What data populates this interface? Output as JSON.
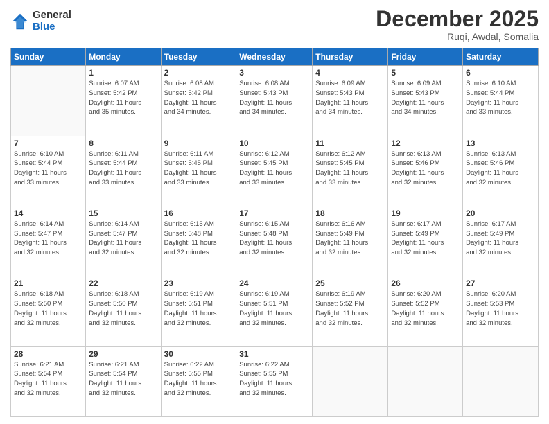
{
  "logo": {
    "general": "General",
    "blue": "Blue"
  },
  "title": "December 2025",
  "location": "Ruqi, Awdal, Somalia",
  "header_days": [
    "Sunday",
    "Monday",
    "Tuesday",
    "Wednesday",
    "Thursday",
    "Friday",
    "Saturday"
  ],
  "weeks": [
    [
      {
        "day": "",
        "info": ""
      },
      {
        "day": "1",
        "info": "Sunrise: 6:07 AM\nSunset: 5:42 PM\nDaylight: 11 hours\nand 35 minutes."
      },
      {
        "day": "2",
        "info": "Sunrise: 6:08 AM\nSunset: 5:42 PM\nDaylight: 11 hours\nand 34 minutes."
      },
      {
        "day": "3",
        "info": "Sunrise: 6:08 AM\nSunset: 5:43 PM\nDaylight: 11 hours\nand 34 minutes."
      },
      {
        "day": "4",
        "info": "Sunrise: 6:09 AM\nSunset: 5:43 PM\nDaylight: 11 hours\nand 34 minutes."
      },
      {
        "day": "5",
        "info": "Sunrise: 6:09 AM\nSunset: 5:43 PM\nDaylight: 11 hours\nand 34 minutes."
      },
      {
        "day": "6",
        "info": "Sunrise: 6:10 AM\nSunset: 5:44 PM\nDaylight: 11 hours\nand 33 minutes."
      }
    ],
    [
      {
        "day": "7",
        "info": "Sunrise: 6:10 AM\nSunset: 5:44 PM\nDaylight: 11 hours\nand 33 minutes."
      },
      {
        "day": "8",
        "info": "Sunrise: 6:11 AM\nSunset: 5:44 PM\nDaylight: 11 hours\nand 33 minutes."
      },
      {
        "day": "9",
        "info": "Sunrise: 6:11 AM\nSunset: 5:45 PM\nDaylight: 11 hours\nand 33 minutes."
      },
      {
        "day": "10",
        "info": "Sunrise: 6:12 AM\nSunset: 5:45 PM\nDaylight: 11 hours\nand 33 minutes."
      },
      {
        "day": "11",
        "info": "Sunrise: 6:12 AM\nSunset: 5:45 PM\nDaylight: 11 hours\nand 33 minutes."
      },
      {
        "day": "12",
        "info": "Sunrise: 6:13 AM\nSunset: 5:46 PM\nDaylight: 11 hours\nand 32 minutes."
      },
      {
        "day": "13",
        "info": "Sunrise: 6:13 AM\nSunset: 5:46 PM\nDaylight: 11 hours\nand 32 minutes."
      }
    ],
    [
      {
        "day": "14",
        "info": "Sunrise: 6:14 AM\nSunset: 5:47 PM\nDaylight: 11 hours\nand 32 minutes."
      },
      {
        "day": "15",
        "info": "Sunrise: 6:14 AM\nSunset: 5:47 PM\nDaylight: 11 hours\nand 32 minutes."
      },
      {
        "day": "16",
        "info": "Sunrise: 6:15 AM\nSunset: 5:48 PM\nDaylight: 11 hours\nand 32 minutes."
      },
      {
        "day": "17",
        "info": "Sunrise: 6:15 AM\nSunset: 5:48 PM\nDaylight: 11 hours\nand 32 minutes."
      },
      {
        "day": "18",
        "info": "Sunrise: 6:16 AM\nSunset: 5:49 PM\nDaylight: 11 hours\nand 32 minutes."
      },
      {
        "day": "19",
        "info": "Sunrise: 6:17 AM\nSunset: 5:49 PM\nDaylight: 11 hours\nand 32 minutes."
      },
      {
        "day": "20",
        "info": "Sunrise: 6:17 AM\nSunset: 5:49 PM\nDaylight: 11 hours\nand 32 minutes."
      }
    ],
    [
      {
        "day": "21",
        "info": "Sunrise: 6:18 AM\nSunset: 5:50 PM\nDaylight: 11 hours\nand 32 minutes."
      },
      {
        "day": "22",
        "info": "Sunrise: 6:18 AM\nSunset: 5:50 PM\nDaylight: 11 hours\nand 32 minutes."
      },
      {
        "day": "23",
        "info": "Sunrise: 6:19 AM\nSunset: 5:51 PM\nDaylight: 11 hours\nand 32 minutes."
      },
      {
        "day": "24",
        "info": "Sunrise: 6:19 AM\nSunset: 5:51 PM\nDaylight: 11 hours\nand 32 minutes."
      },
      {
        "day": "25",
        "info": "Sunrise: 6:19 AM\nSunset: 5:52 PM\nDaylight: 11 hours\nand 32 minutes."
      },
      {
        "day": "26",
        "info": "Sunrise: 6:20 AM\nSunset: 5:52 PM\nDaylight: 11 hours\nand 32 minutes."
      },
      {
        "day": "27",
        "info": "Sunrise: 6:20 AM\nSunset: 5:53 PM\nDaylight: 11 hours\nand 32 minutes."
      }
    ],
    [
      {
        "day": "28",
        "info": "Sunrise: 6:21 AM\nSunset: 5:54 PM\nDaylight: 11 hours\nand 32 minutes."
      },
      {
        "day": "29",
        "info": "Sunrise: 6:21 AM\nSunset: 5:54 PM\nDaylight: 11 hours\nand 32 minutes."
      },
      {
        "day": "30",
        "info": "Sunrise: 6:22 AM\nSunset: 5:55 PM\nDaylight: 11 hours\nand 32 minutes."
      },
      {
        "day": "31",
        "info": "Sunrise: 6:22 AM\nSunset: 5:55 PM\nDaylight: 11 hours\nand 32 minutes."
      },
      {
        "day": "",
        "info": ""
      },
      {
        "day": "",
        "info": ""
      },
      {
        "day": "",
        "info": ""
      }
    ]
  ]
}
